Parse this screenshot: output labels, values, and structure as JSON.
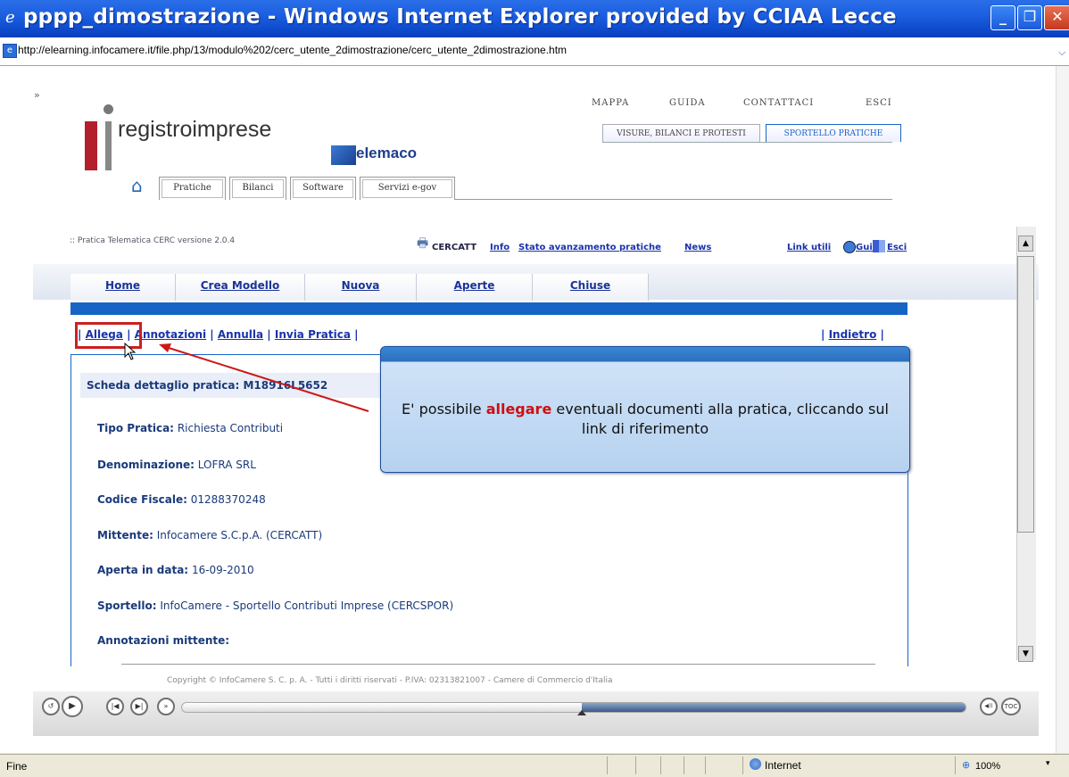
{
  "window": {
    "title": "pppp_dimostrazione - Windows Internet Explorer provided by CCIAA Lecce",
    "address": "http://elearning.infocamere.it/file.php/13/modulo%202/cerc_utente_2dimostrazione/cerc_utente_2dimostrazione.htm"
  },
  "header": {
    "brand": "registroimprese",
    "sub_brand": "elemaco",
    "top_links": [
      "MAPPA",
      "GUIDA",
      "CONTATTACI",
      "ESCI"
    ],
    "top_buttons": [
      "VISURE, BILANCI E PROTESTI",
      "SPORTELLO PRATICHE"
    ],
    "tabs": [
      "Pratiche",
      "Bilanci",
      "Software",
      "Servizi e-gov"
    ]
  },
  "app_bar": {
    "version": ":: Pratica Telematica CERC versione 2.0.4",
    "cercatt": "CERCATT",
    "links": [
      "Info",
      "Stato avanzamento pratiche",
      "News",
      "Link utili",
      "Guida",
      "Esci"
    ]
  },
  "nav": [
    "Home",
    "Crea Modello",
    "Nuova",
    "Aperte",
    "Chiuse"
  ],
  "actions": [
    "Allega",
    "Annotazioni",
    "Annulla",
    "Invia Pratica"
  ],
  "back_link": "Indietro",
  "detail": {
    "heading": "Scheda dettaglio pratica: M18916L5652",
    "fields": [
      {
        "label": "Tipo Pratica:",
        "value": "Richiesta Contributi"
      },
      {
        "label": "Denominazione:",
        "value": "LOFRA SRL"
      },
      {
        "label": "Codice Fiscale:",
        "value": "01288370248"
      },
      {
        "label": "Mittente:",
        "value": "Infocamere S.C.p.A. (CERCATT)"
      },
      {
        "label": "Aperta in data:",
        "value": "16-09-2010"
      },
      {
        "label": "Sportello:",
        "value": "InfoCamere - Sportello Contributi Imprese (CERCSPOR)"
      },
      {
        "label": "Annotazioni mittente:",
        "value": ""
      }
    ]
  },
  "callout": {
    "prefix": "E' possibile ",
    "emphasis": "allegare",
    "suffix": " eventuali documenti alla pratica, cliccando sul link di riferimento"
  },
  "footer": {
    "copyright": "Copyright © InfoCamere S. C. p. A. - Tutti i diritti riservati - P.IVA: 02313821007 - Camere di Commercio d'Italia"
  },
  "player": {
    "buttons": [
      "↺",
      "▶",
      "|◀",
      "▶|",
      "»"
    ],
    "right_buttons": [
      "◀))",
      "TOC"
    ],
    "progress": 0.51
  },
  "statusbar": {
    "status": "Fine",
    "zone": "Internet",
    "zoom": "100%"
  },
  "colors": {
    "accent": "#1665c4",
    "highlight": "#cc2020",
    "link": "#1a33aa"
  }
}
